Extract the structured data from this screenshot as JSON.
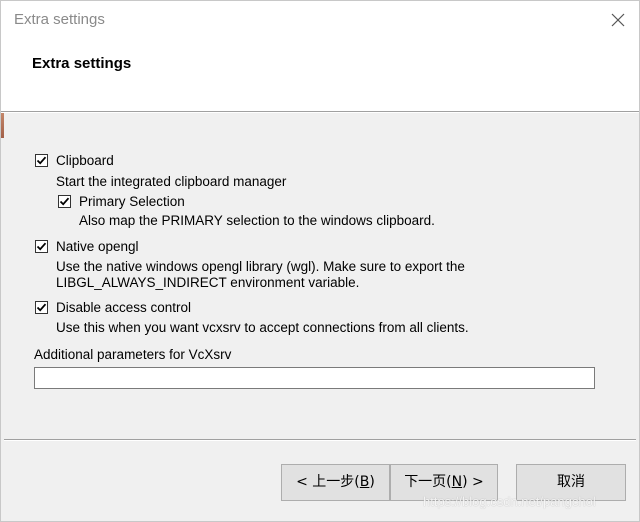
{
  "window": {
    "title": "Extra settings"
  },
  "header": {
    "heading": "Extra settings"
  },
  "options": {
    "clipboard": {
      "label": "Clipboard",
      "checked": true,
      "description": "Start the integrated clipboard manager"
    },
    "primary_selection": {
      "label": "Primary Selection",
      "checked": true,
      "description": "Also map the PRIMARY selection to the windows clipboard."
    },
    "native_opengl": {
      "label": "Native opengl",
      "checked": true,
      "description_line1": "Use the native windows opengl library (wgl). Make sure to export the",
      "description_line2": "LIBGL_ALWAYS_INDIRECT environment variable."
    },
    "disable_access_control": {
      "label": "Disable access control",
      "checked": true,
      "description": "Use this when you want vcxsrv to accept connections from all clients."
    }
  },
  "additional_params": {
    "label": "Additional parameters for VcXsrv",
    "value": ""
  },
  "buttons": {
    "back_prefix": "< 上一步(",
    "back_key": "B",
    "back_suffix": ")",
    "next_prefix": "下一页(",
    "next_key": "N",
    "next_suffix": ") >",
    "cancel": "取消"
  },
  "watermark": "https://blog.csdn.net/pangchol",
  "icons": {
    "close": "close-icon",
    "check": "check-icon"
  }
}
